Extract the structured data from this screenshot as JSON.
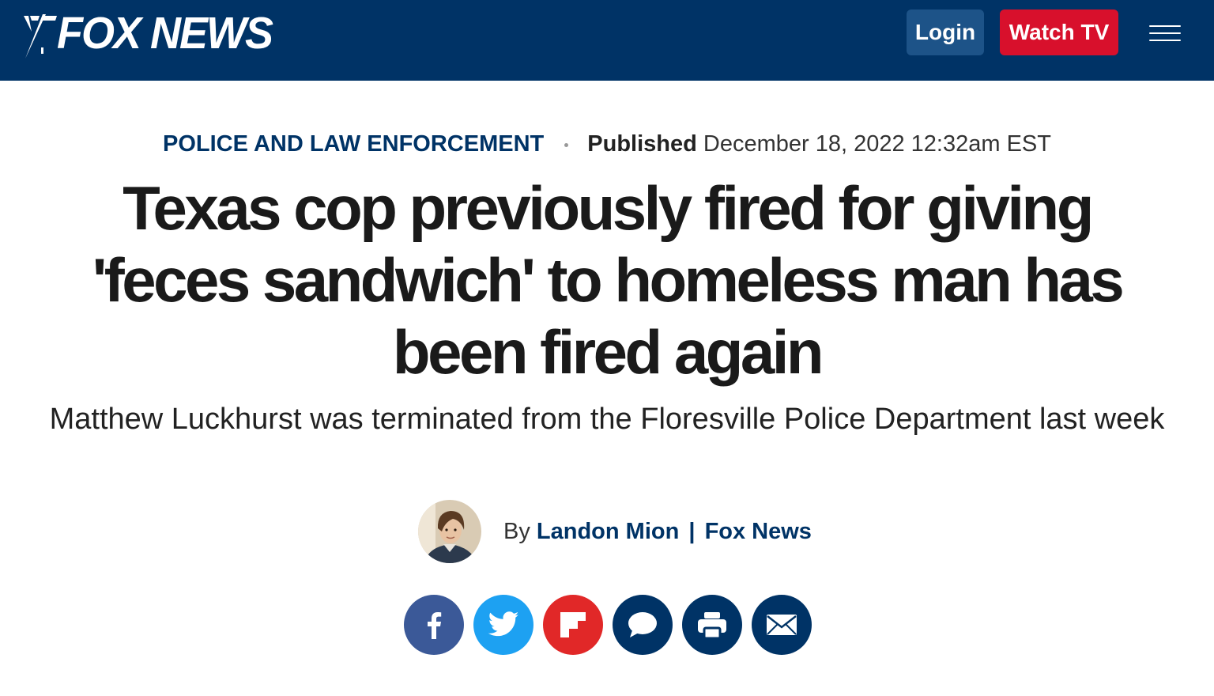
{
  "header": {
    "logo_text": "FOX NEWS",
    "login_label": "Login",
    "watch_label": "Watch TV",
    "colors": {
      "bar": "#003366",
      "login": "#1d5388",
      "watch": "#d8102c"
    }
  },
  "article": {
    "category": "POLICE AND LAW ENFORCEMENT",
    "published_label": "Published",
    "published_date": "December 18, 2022 12:32am EST",
    "headline": "Texas cop previously fired for giving 'feces sandwich' to homeless man has been fired again",
    "subheadline": "Matthew Luckhurst was terminated from the Floresville Police Department last week",
    "byline_prefix": "By",
    "author": "Landon Mion",
    "byline_sep": "|",
    "outlet": "Fox News"
  },
  "share": [
    {
      "icon": "facebook-icon",
      "color": "#3b5998"
    },
    {
      "icon": "twitter-icon",
      "color": "#1da1f2"
    },
    {
      "icon": "flipboard-icon",
      "color": "#e12828"
    },
    {
      "icon": "comment-icon",
      "color": "#003366"
    },
    {
      "icon": "print-icon",
      "color": "#003366"
    },
    {
      "icon": "email-icon",
      "color": "#003366"
    }
  ]
}
